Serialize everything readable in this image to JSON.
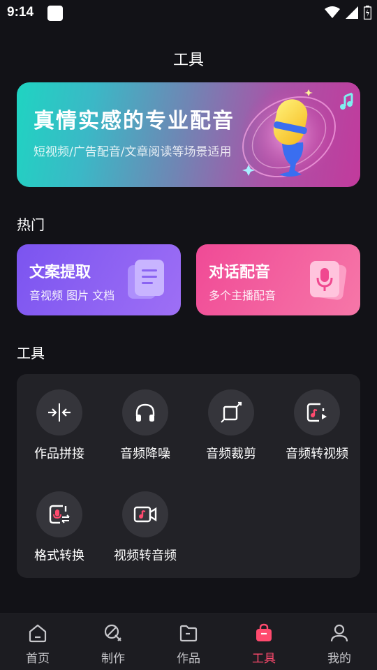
{
  "status": {
    "time": "9:14"
  },
  "header": {
    "title": "工具"
  },
  "banner": {
    "title": "真情实感的专业配音",
    "subtitle": "短视频/广告配音/文章阅读等场景适用"
  },
  "hot": {
    "label": "热门",
    "cards": [
      {
        "title": "文案提取",
        "subtitle": "音视频 图片 文档"
      },
      {
        "title": "对话配音",
        "subtitle": "多个主播配音"
      }
    ]
  },
  "tools": {
    "label": "工具",
    "items": [
      {
        "label": "作品拼接",
        "icon": "merge-icon"
      },
      {
        "label": "音频降噪",
        "icon": "headphones-icon"
      },
      {
        "label": "音频裁剪",
        "icon": "crop-icon"
      },
      {
        "label": "音频转视频",
        "icon": "audio-to-video-icon"
      },
      {
        "label": "格式转换",
        "icon": "format-convert-icon"
      },
      {
        "label": "视频转音频",
        "icon": "video-to-audio-icon"
      }
    ]
  },
  "nav": {
    "items": [
      {
        "label": "首页",
        "icon": "home-icon"
      },
      {
        "label": "制作",
        "icon": "make-icon"
      },
      {
        "label": "作品",
        "icon": "folder-icon"
      },
      {
        "label": "工具",
        "icon": "toolbag-icon",
        "active": true
      },
      {
        "label": "我的",
        "icon": "user-icon"
      }
    ]
  },
  "colors": {
    "accent": "#ff4a6e",
    "background": "#121217",
    "panel": "#222227"
  }
}
